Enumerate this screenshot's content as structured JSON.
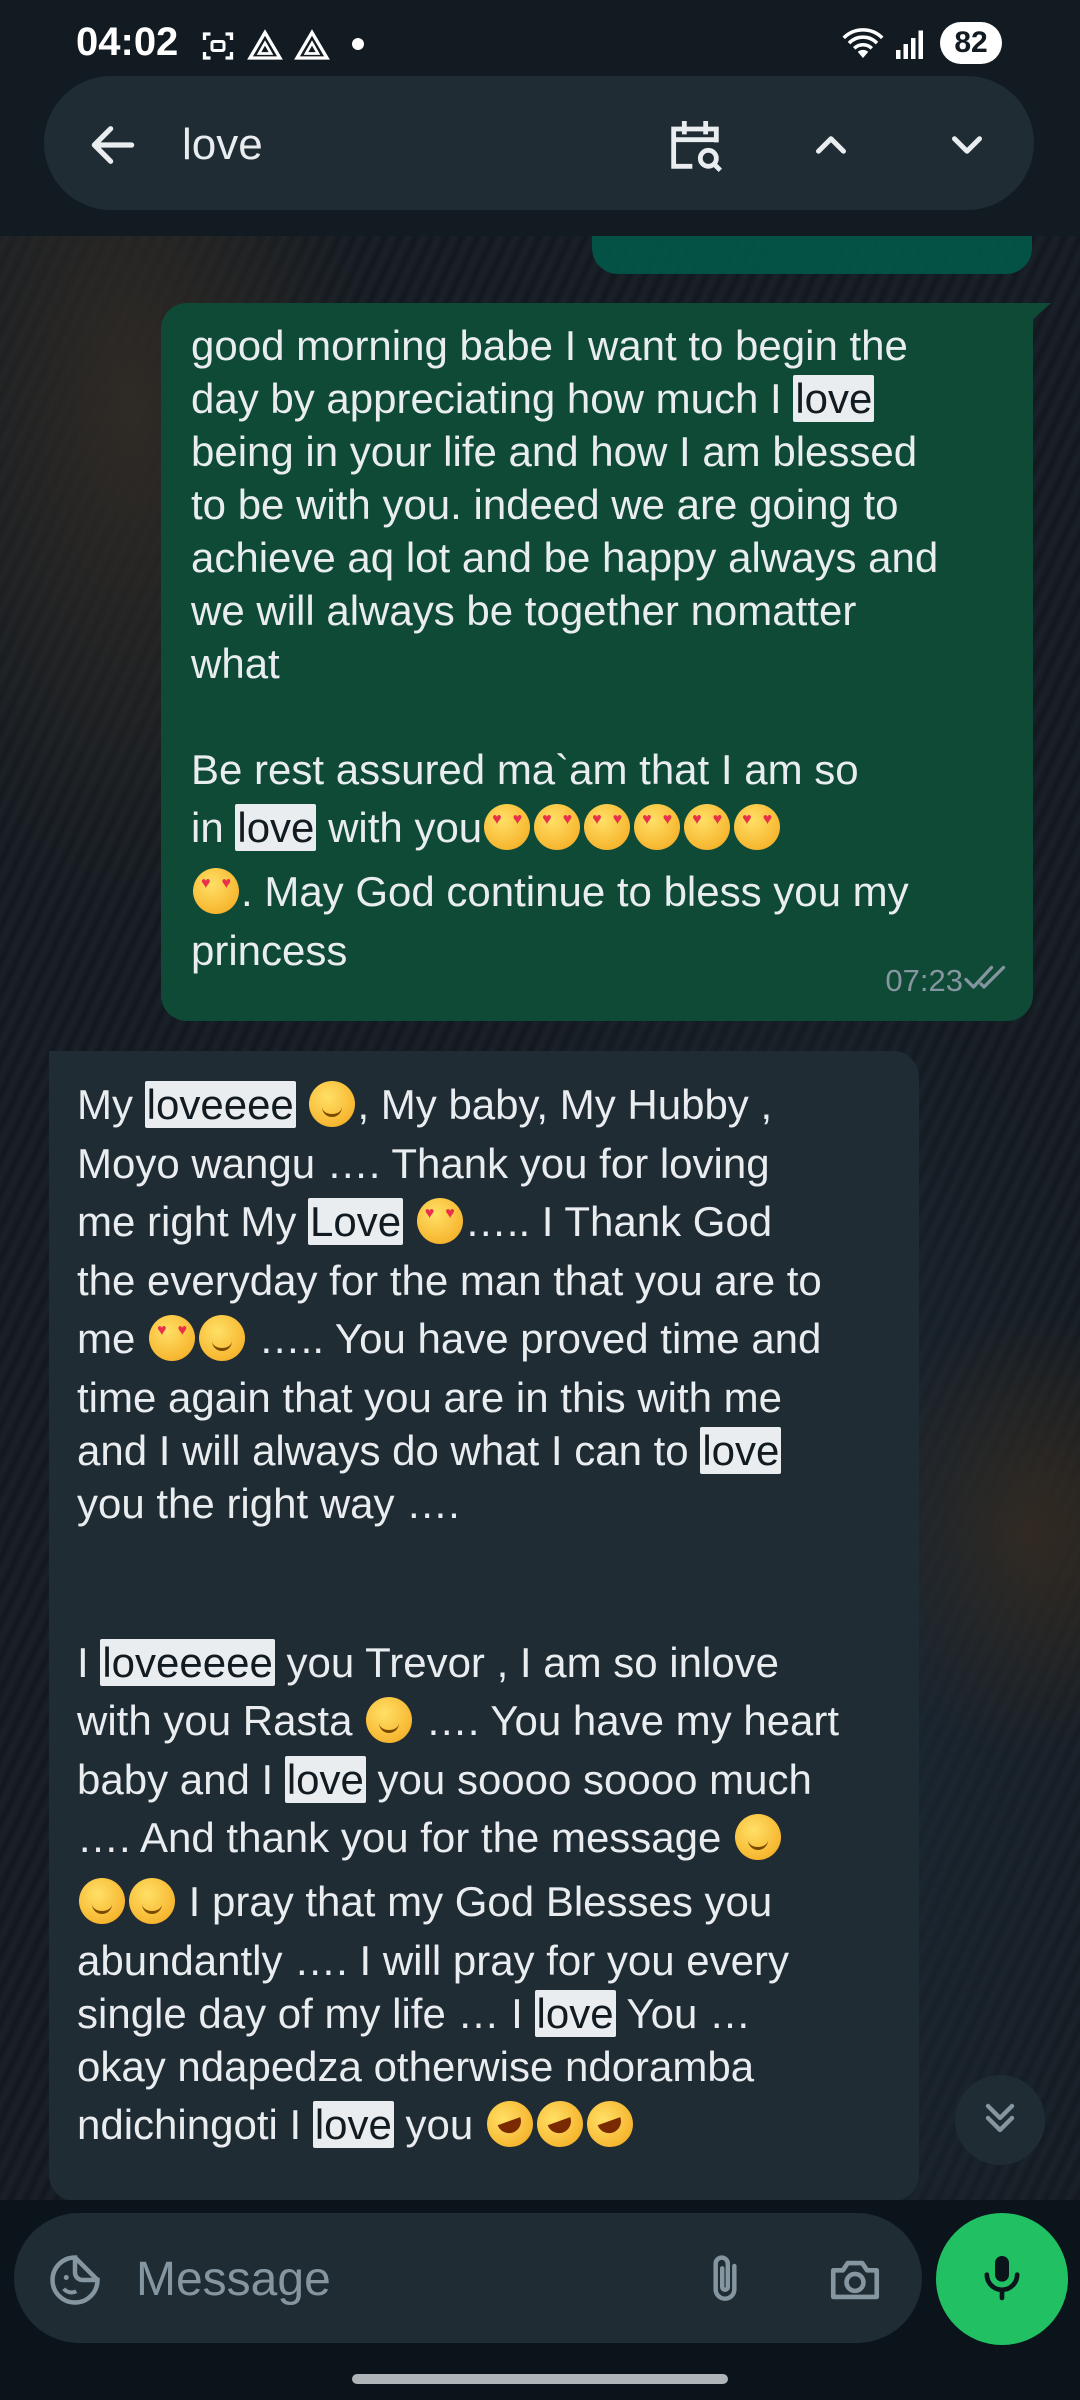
{
  "status_bar": {
    "time": "04:02",
    "battery": "82",
    "icons": [
      "screenshot-icon",
      "drive-icon",
      "drive-icon",
      "dot-icon",
      "wifi-icon",
      "signal-icon"
    ]
  },
  "search": {
    "query": "love",
    "back_icon": "arrow-left-icon",
    "calendar_icon": "calendar-search-icon",
    "prev_icon": "chevron-up-icon",
    "next_icon": "chevron-down-icon"
  },
  "outgoing": {
    "lines": [
      [
        {
          "t": "good morning babe I want to begin the"
        }
      ],
      [
        {
          "t": "day by appreciating how much I "
        },
        {
          "t": "love",
          "hl": true
        }
      ],
      [
        {
          "t": "being in your life and how I am blessed"
        }
      ],
      [
        {
          "t": "to be with you. indeed we are going to"
        }
      ],
      [
        {
          "t": "achieve aq lot and be happy always and"
        }
      ],
      [
        {
          "t": "we will always be together nomatter"
        }
      ],
      [
        {
          "t": "what"
        }
      ],
      [
        {
          "t": ""
        }
      ],
      [
        {
          "t": "Be rest assured ma`am  that I am so"
        }
      ],
      [
        {
          "t": "in "
        },
        {
          "t": "love",
          "hl": true
        },
        {
          "t": " with you"
        },
        {
          "e": "heart"
        },
        {
          "e": "heart"
        },
        {
          "e": "heart"
        },
        {
          "e": "heart"
        },
        {
          "e": "heart"
        },
        {
          "e": "heart"
        }
      ],
      [
        {
          "e": "heart"
        },
        {
          "t": ". May God continue to bless you my"
        }
      ],
      [
        {
          "t": "princess"
        }
      ]
    ],
    "time": "07:23",
    "status": "read"
  },
  "incoming": {
    "lines": [
      [
        {
          "t": "My "
        },
        {
          "t": "loveeee",
          "hl": true
        },
        {
          "t": " "
        },
        {
          "e": "smile"
        },
        {
          "t": ", My baby, My Hubby ,"
        }
      ],
      [
        {
          "t": "Moyo wangu …. Thank you for loving"
        }
      ],
      [
        {
          "t": "me right My "
        },
        {
          "t": "Love",
          "hl": true
        },
        {
          "t": " "
        },
        {
          "e": "heart"
        },
        {
          "t": "….. I Thank God"
        }
      ],
      [
        {
          "t": "the everyday for the man that you are to"
        }
      ],
      [
        {
          "t": "me "
        },
        {
          "e": "heart"
        },
        {
          "e": "smile"
        },
        {
          "t": " ….. You have proved time and"
        }
      ],
      [
        {
          "t": "time again that you are in this with me"
        }
      ],
      [
        {
          "t": "and I will always do what I can to "
        },
        {
          "t": "love",
          "hl": true
        }
      ],
      [
        {
          "t": "you the right way …."
        }
      ],
      [
        {
          "t": ""
        }
      ],
      [
        {
          "t": ""
        }
      ],
      [
        {
          "t": "I "
        },
        {
          "t": "loveeeee",
          "hl": true
        },
        {
          "t": " you Trevor , I am so inlove"
        }
      ],
      [
        {
          "t": "with you Rasta "
        },
        {
          "e": "smile"
        },
        {
          "t": " …. You have my heart"
        }
      ],
      [
        {
          "t": "baby and I "
        },
        {
          "t": "love",
          "hl": true
        },
        {
          "t": " you soooo soooo much"
        }
      ],
      [
        {
          "t": "…. And thank you for the message "
        },
        {
          "e": "smile"
        }
      ],
      [
        {
          "e": "smile"
        },
        {
          "e": "smile"
        },
        {
          "t": " I pray that my God Blesses you"
        }
      ],
      [
        {
          "t": "abundantly …. I will pray for you every"
        }
      ],
      [
        {
          "t": "single day of my life … I "
        },
        {
          "t": "love",
          "hl": true
        },
        {
          "t": " You …"
        }
      ],
      [
        {
          "t": "okay ndapedza otherwise ndoramba"
        }
      ],
      [
        {
          "t": "ndichingoti I "
        },
        {
          "t": "love",
          "hl": true
        },
        {
          "t": " you "
        },
        {
          "e": "laugh"
        },
        {
          "e": "laugh"
        },
        {
          "e": "laugh"
        }
      ]
    ]
  },
  "composer": {
    "placeholder": "Message",
    "sticker_icon": "sticker-icon",
    "attach_icon": "paperclip-icon",
    "camera_icon": "camera-icon",
    "mic_icon": "mic-icon"
  },
  "scroll_button_icon": "double-chevron-down-icon"
}
